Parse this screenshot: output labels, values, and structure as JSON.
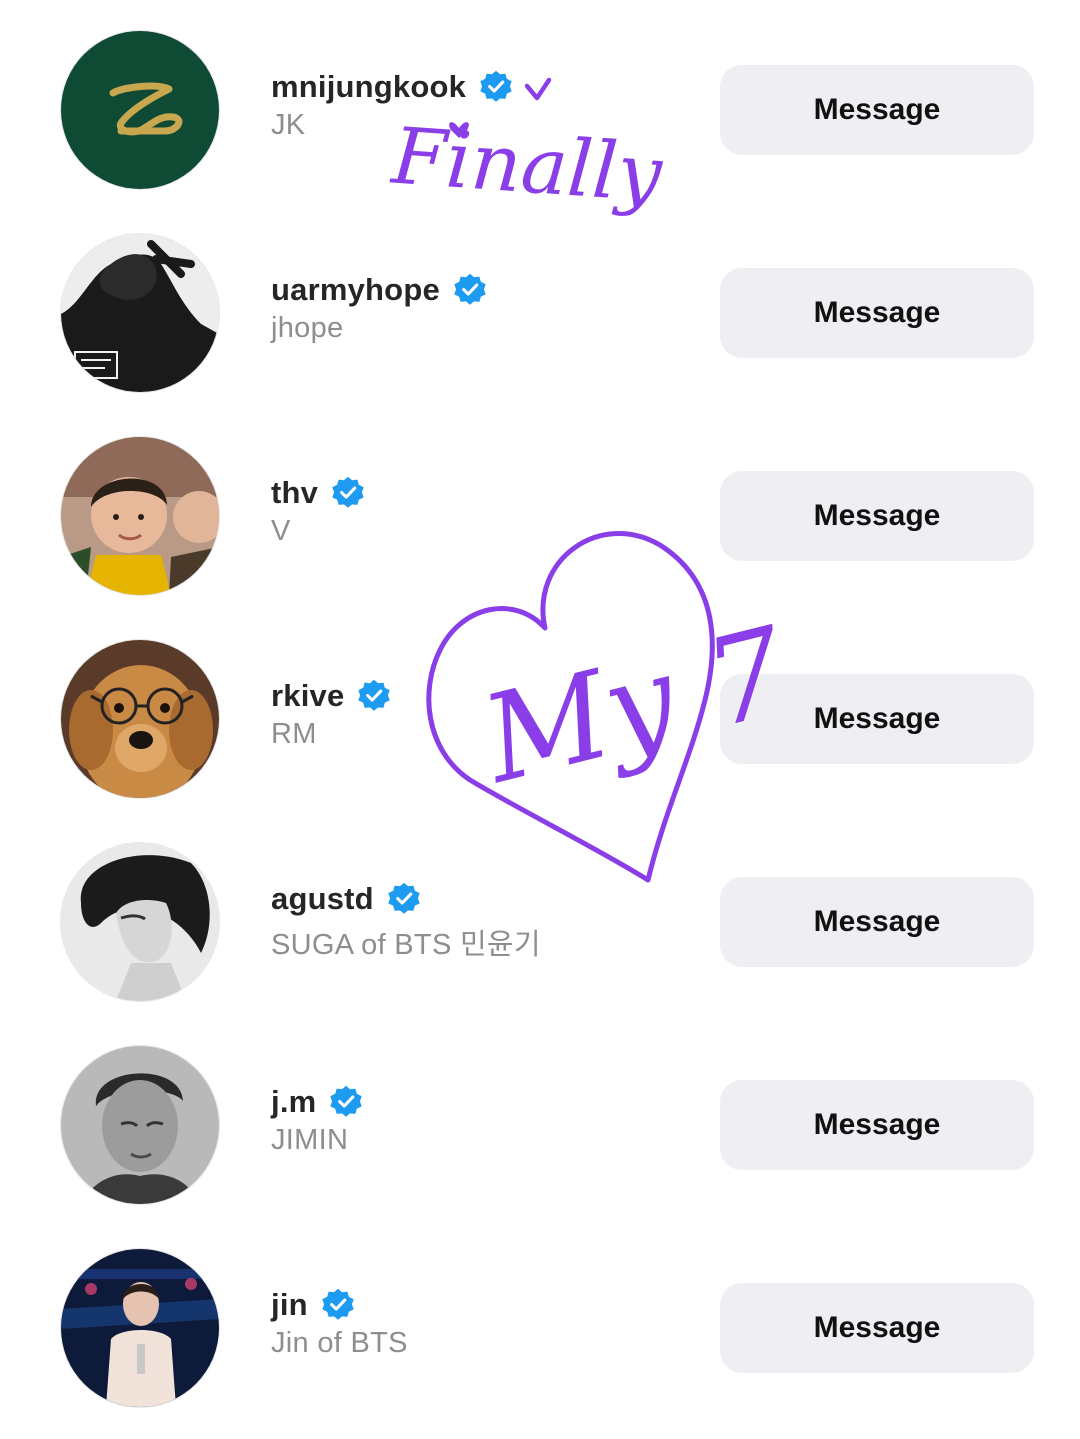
{
  "accounts": [
    {
      "username": "mnijungkook",
      "full_name": "JK",
      "button": "Message",
      "avatar": "logo-avatar"
    },
    {
      "username": "uarmyhope",
      "full_name": "jhope",
      "button": "Message",
      "avatar": "photo-avatar"
    },
    {
      "username": "thv",
      "full_name": "V",
      "button": "Message",
      "avatar": "photo-avatar"
    },
    {
      "username": "rkive",
      "full_name": "RM",
      "button": "Message",
      "avatar": "dog-photo-avatar"
    },
    {
      "username": "agustd",
      "full_name": "SUGA of BTS 민윤기",
      "button": "Message",
      "avatar": "photo-avatar"
    },
    {
      "username": "j.m",
      "full_name": "JIMIN",
      "button": "Message",
      "avatar": "photo-avatar"
    },
    {
      "username": "jin",
      "full_name": "Jin of BTS",
      "button": "Message",
      "avatar": "photo-avatar"
    }
  ],
  "annotations": {
    "finally": "Finally",
    "my7": "My 7"
  },
  "colors": {
    "verified_blue": "#1d9bf0",
    "button_bg": "#efeff3",
    "annotation_purple": "#8a3ee8",
    "username_text": "#262626",
    "fullname_text": "#8e8e8e"
  }
}
